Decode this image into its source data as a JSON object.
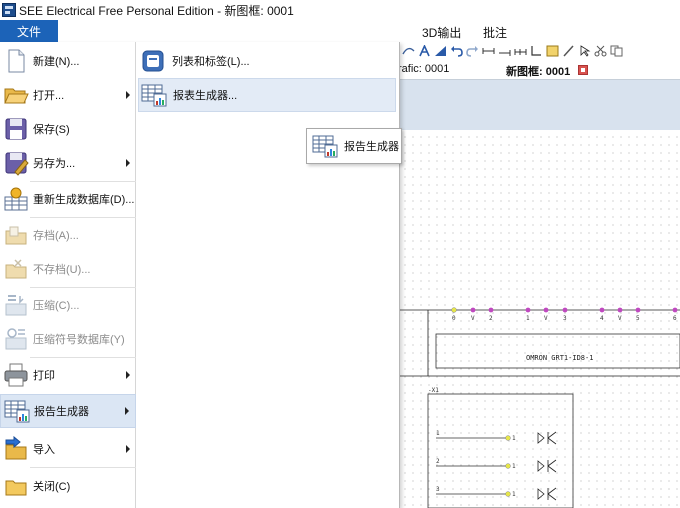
{
  "window": {
    "title": "SEE Electrical Free Personal Edition - 新图框: 0001",
    "icon": "app-icon"
  },
  "ribbon": {
    "file_tab": "文件",
    "tabs": [
      "3D输出",
      "批注"
    ]
  },
  "toolbar": {
    "icons": [
      "arc-icon",
      "text-a-icon",
      "text-style-icon",
      "undo-icon",
      "redo-icon",
      "dimension-icon",
      "dimension-align-icon",
      "dimension-chain-icon",
      "line-corner-icon",
      "text-box-icon",
      "pen-icon",
      "pointer-icon",
      "cut-icon",
      "copy-icon"
    ]
  },
  "document_tabs": [
    {
      "label": "rafic: 0001",
      "active": false
    },
    {
      "label": "新图框: 0001",
      "active": true
    }
  ],
  "file_menu": {
    "items": [
      {
        "label": "新建(N)...",
        "icon": "new-document-icon",
        "has_submenu": false,
        "disabled": false
      },
      {
        "label": "打开...",
        "icon": "open-folder-icon",
        "has_submenu": true,
        "disabled": false
      },
      {
        "label": "保存(S)",
        "icon": "save-icon",
        "has_submenu": false,
        "disabled": false
      },
      {
        "label": "另存为...",
        "icon": "save-as-icon",
        "has_submenu": true,
        "disabled": false
      },
      {
        "label": "重新生成数据库(D)...",
        "icon": "rebuild-database-icon",
        "has_submenu": false,
        "disabled": false
      },
      {
        "label": "存档(A)...",
        "icon": "archive-icon",
        "has_submenu": false,
        "disabled": true
      },
      {
        "label": "不存档(U)...",
        "icon": "unarchive-icon",
        "has_submenu": false,
        "disabled": true
      },
      {
        "label": "压缩(C)...",
        "icon": "compress-icon",
        "has_submenu": false,
        "disabled": true
      },
      {
        "label": "压缩符号数据库(Y)",
        "icon": "compress-symbol-db-icon",
        "has_submenu": false,
        "disabled": true
      },
      {
        "label": "打印",
        "icon": "printer-icon",
        "has_submenu": true,
        "disabled": false
      },
      {
        "label": "报告生成器",
        "icon": "report-generator-icon",
        "has_submenu": true,
        "disabled": false,
        "highlighted": true
      },
      {
        "label": "导入",
        "icon": "import-icon",
        "has_submenu": true,
        "disabled": false
      },
      {
        "label": "关闭(C)",
        "icon": "close-folder-icon",
        "has_submenu": false,
        "disabled": false
      }
    ]
  },
  "submenu": {
    "items": [
      {
        "label": "列表和标签(L)...",
        "icon": "list-labels-icon"
      },
      {
        "label": "报表生成器...",
        "icon": "report-builder-icon",
        "highlighted": true
      }
    ]
  },
  "tooltip": {
    "label": "报告生成器",
    "icon": "report-generator-icon"
  },
  "drawing": {
    "terminal_labels": [
      "0",
      "V",
      "2",
      "1",
      "V",
      "3",
      "4",
      "V",
      "5",
      "6"
    ],
    "device_label": "OMRON   GRT1-ID8-1",
    "component_tag": "-X1",
    "row_numbers": [
      "1",
      "2",
      "3"
    ],
    "pin_label": "1"
  }
}
